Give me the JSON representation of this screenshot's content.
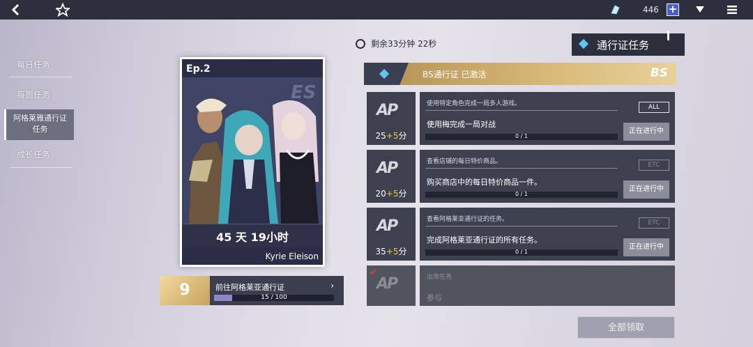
{
  "topbar": {
    "currency_count": "446",
    "plus_label": "+"
  },
  "nav": {
    "items": [
      {
        "label": "每日任务"
      },
      {
        "label": "每周任务"
      },
      {
        "label": "阿格莱雅通行证任务"
      },
      {
        "label": "成长任务"
      }
    ],
    "active_line1": "阿格莱雅通行证",
    "active_line2": "任务"
  },
  "card": {
    "episode": "Ep.2",
    "time_left": "45 天 19小时",
    "subtitle": "Kyrie Eleison"
  },
  "level": {
    "number": "9",
    "label": "前往阿格莱亚通行证",
    "arrow": "›",
    "progress_text": "15 / 100",
    "progress": 0.15
  },
  "header": {
    "timer": "剩余33分钟 22秒",
    "tab_title": "通行证任务"
  },
  "pass": {
    "status": "BS通行证 已激活",
    "logo": "BS"
  },
  "quests": [
    {
      "points": "25",
      "bonus": "+5",
      "unit": "分",
      "desc": "使用特定角色完成一局多人游戏。",
      "tag": "ALL",
      "title": "使用梅完成一局对战",
      "progress": "0 / 1",
      "button": "正在进行中"
    },
    {
      "points": "20",
      "bonus": "+5",
      "unit": "分",
      "desc": "查看店铺的每日特价商品。",
      "tag": "ETC",
      "title": "购买商店中的每日特价商品一件。",
      "progress": "0 / 1",
      "button": "正在进行中"
    },
    {
      "points": "35",
      "bonus": "+5",
      "unit": "分",
      "desc": "查看阿格莱亚通行证的任务。",
      "tag": "ETC",
      "title": "完成阿格莱亚通行证的所有任务。",
      "progress": "0 / 1",
      "button": "正在进行中"
    },
    {
      "desc": "出席任务",
      "title": "参与"
    }
  ],
  "claim_all": "全部领取",
  "colors": {
    "accent_gold": "#d9b978",
    "bonus_yellow": "#f1c74c",
    "panel": "#3d404f",
    "diamond_blue": "#5ec5ee"
  }
}
